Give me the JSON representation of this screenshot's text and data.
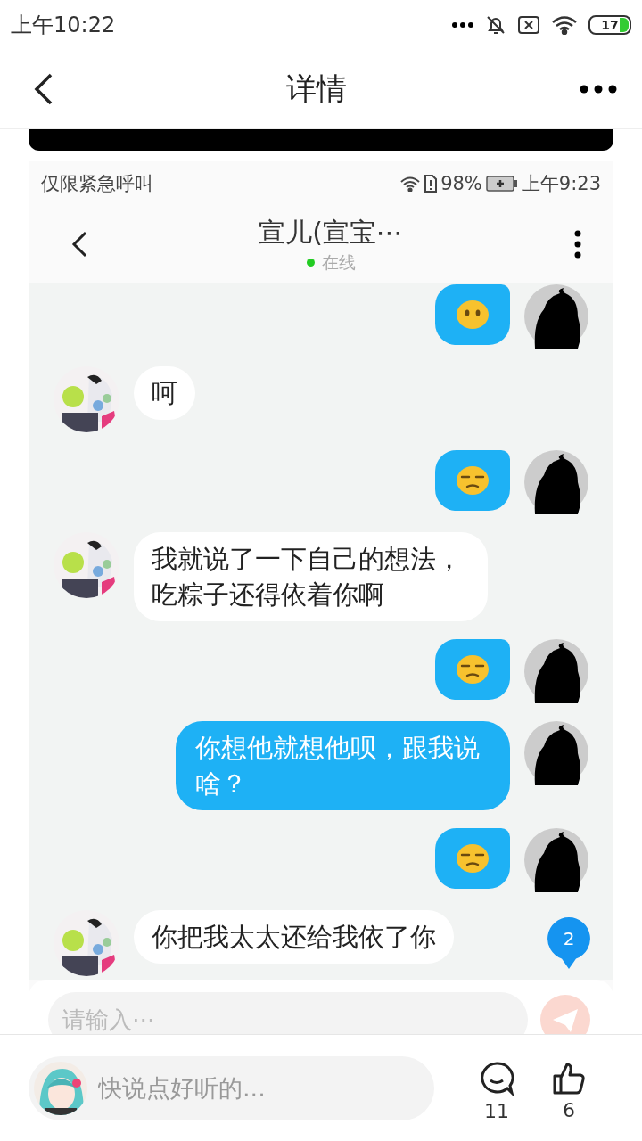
{
  "status_bar": {
    "time": "上午10:22",
    "battery": "17"
  },
  "header": {
    "title": "详情"
  },
  "shot": {
    "status_bar": {
      "carrier": "仅限紧急呼叫",
      "battery": "98%",
      "time": "上午9:23"
    },
    "chat": {
      "title": "宣儿(宣宝⋯",
      "presence": "在线"
    },
    "messages": [
      {
        "sent": true,
        "kind": "emoji_plain"
      },
      {
        "sent": false,
        "kind": "text",
        "text": "呵"
      },
      {
        "sent": true,
        "kind": "emoji_unamused"
      },
      {
        "sent": false,
        "kind": "text",
        "text": "我就说了一下自己的想法，吃粽子还得依着你啊"
      },
      {
        "sent": true,
        "kind": "emoji_unamused"
      },
      {
        "sent": true,
        "kind": "text",
        "text": "你想他就想他呗，跟我说啥？"
      },
      {
        "sent": true,
        "kind": "emoji_unamused"
      },
      {
        "sent": false,
        "kind": "text",
        "text": "你把我太太还给我依了你"
      }
    ],
    "unread_badge": "2",
    "input": {
      "placeholder": "请输入⋯"
    }
  },
  "bottom_bar": {
    "placeholder": "快说点好听的...",
    "comments": "11",
    "likes": "6"
  }
}
